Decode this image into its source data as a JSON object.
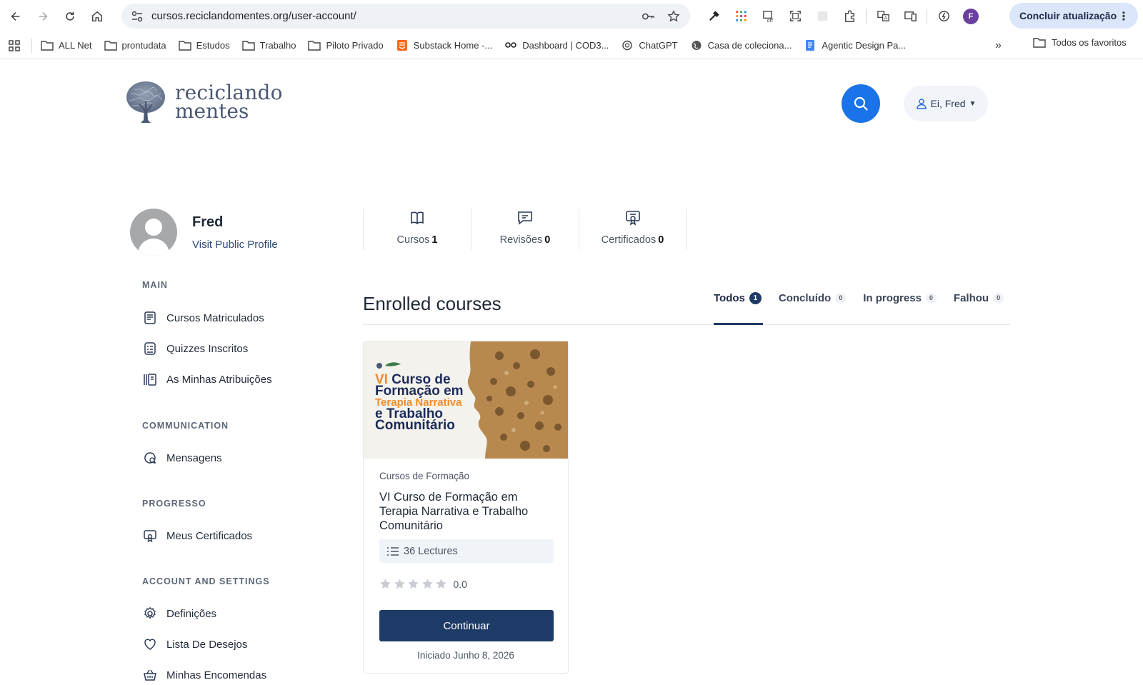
{
  "browser": {
    "url": "cursos.reciclandomentes.org/user-account/",
    "profile_initial": "F",
    "update_label": "Concluir atualização",
    "bookmarks": [
      "ALL Net",
      "prontudata",
      "Estudos",
      "Trabalho",
      "Piloto Privado",
      "Substack Home -...",
      "Dashboard | COD3...",
      "ChatGPT",
      "Casa de coleciona...",
      "Agentic Design Pa..."
    ],
    "bookmarks_more": "»",
    "all_bookmarks": "Todos os favoritos"
  },
  "site": {
    "logo_line1": "reciclando",
    "logo_line2": "mentes",
    "user_greeting": "Ei, Fred"
  },
  "profile": {
    "name": "Fred",
    "public_link": "Visit Public Profile",
    "stats": [
      {
        "label": "Cursos",
        "count": "1",
        "icon": "book-icon"
      },
      {
        "label": "Revisões",
        "count": "0",
        "icon": "chat-icon"
      },
      {
        "label": "Certificados",
        "count": "0",
        "icon": "certificate-icon"
      }
    ]
  },
  "sidebar": {
    "sections": [
      {
        "title": "MAIN",
        "items": [
          {
            "label": "Cursos Matriculados",
            "icon": "enrolled-courses-icon"
          },
          {
            "label": "Quizzes Inscritos",
            "icon": "quiz-icon"
          },
          {
            "label": "As Minhas Atribuições",
            "icon": "assignments-icon"
          }
        ]
      },
      {
        "title": "COMMUNICATION",
        "items": [
          {
            "label": "Mensagens",
            "icon": "messages-icon"
          }
        ]
      },
      {
        "title": "PROGRESSO",
        "items": [
          {
            "label": "Meus Certificados",
            "icon": "certificate-icon"
          }
        ]
      },
      {
        "title": "ACCOUNT AND SETTINGS",
        "items": [
          {
            "label": "Definições",
            "icon": "gear-icon"
          },
          {
            "label": "Lista De Desejos",
            "icon": "heart-icon"
          },
          {
            "label": "Minhas Encomendas",
            "icon": "basket-icon"
          }
        ]
      }
    ]
  },
  "main": {
    "title": "Enrolled courses",
    "tabs": [
      {
        "label": "Todos",
        "count": "1",
        "active": true
      },
      {
        "label": "Concluído",
        "count": "0"
      },
      {
        "label": "In progress",
        "count": "0"
      },
      {
        "label": "Falhou",
        "count": "0"
      }
    ]
  },
  "course": {
    "thumb_vi": "VI",
    "thumb_line1": "Curso de",
    "thumb_line2": "Formação em",
    "thumb_line3": "Terapia Narrativa",
    "thumb_line4": "e Trabalho",
    "thumb_line5": "Comunitário",
    "category": "Cursos de Formação",
    "title": "VI Curso de Formação em Terapia Narrativa e Trabalho Comunitário",
    "lectures": "36 Lectures",
    "rating": "0.0",
    "rating_stars": 0,
    "button": "Continuar",
    "started": "Iniciado Junho 8, 2026"
  },
  "colors": {
    "primary_blue": "#1a73e8",
    "navy": "#1e3a66",
    "accent_orange": "#f08a2a"
  }
}
